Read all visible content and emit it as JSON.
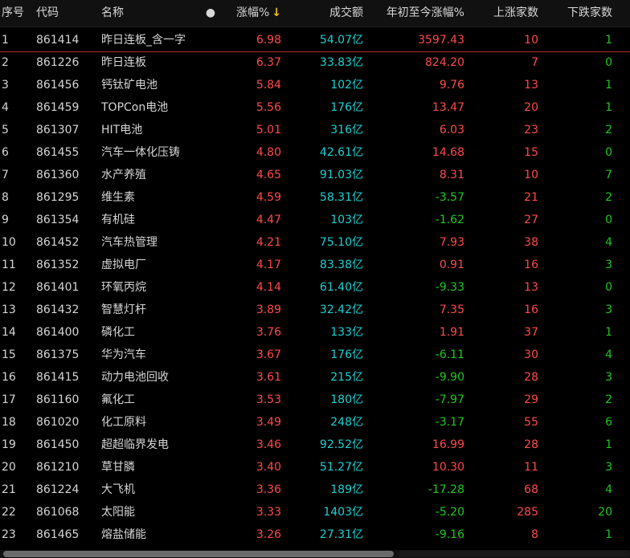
{
  "headers": {
    "idx": "序号",
    "code": "代码",
    "name": "名称",
    "dot": "●",
    "change": "涨幅%",
    "sort_arrow": "↓",
    "volume": "成交额",
    "ytd": "年初至今涨幅%",
    "up": "上涨家数",
    "down": "下跌家数"
  },
  "rows": [
    {
      "idx": "1",
      "code": "861414",
      "name": "昨日连板_含一字",
      "change": "6.98",
      "volume": "54.07亿",
      "ytd": "3597.43",
      "up": "10",
      "down": "1"
    },
    {
      "idx": "2",
      "code": "861226",
      "name": "昨日连板",
      "change": "6.37",
      "volume": "33.83亿",
      "ytd": "824.20",
      "up": "7",
      "down": "0"
    },
    {
      "idx": "3",
      "code": "861456",
      "name": "钙钛矿电池",
      "change": "5.84",
      "volume": "102亿",
      "ytd": "9.76",
      "up": "13",
      "down": "1"
    },
    {
      "idx": "4",
      "code": "861459",
      "name": "TOPCon电池",
      "change": "5.56",
      "volume": "176亿",
      "ytd": "13.47",
      "up": "20",
      "down": "1"
    },
    {
      "idx": "5",
      "code": "861307",
      "name": "HIT电池",
      "change": "5.01",
      "volume": "316亿",
      "ytd": "6.03",
      "up": "23",
      "down": "2"
    },
    {
      "idx": "6",
      "code": "861455",
      "name": "汽车一体化压铸",
      "change": "4.80",
      "volume": "42.61亿",
      "ytd": "14.68",
      "up": "15",
      "down": "0"
    },
    {
      "idx": "7",
      "code": "861360",
      "name": "水产养殖",
      "change": "4.65",
      "volume": "91.03亿",
      "ytd": "8.31",
      "up": "10",
      "down": "7"
    },
    {
      "idx": "8",
      "code": "861295",
      "name": "维生素",
      "change": "4.59",
      "volume": "58.31亿",
      "ytd": "-3.57",
      "up": "21",
      "down": "2"
    },
    {
      "idx": "9",
      "code": "861354",
      "name": "有机硅",
      "change": "4.47",
      "volume": "103亿",
      "ytd": "-1.62",
      "up": "27",
      "down": "0"
    },
    {
      "idx": "10",
      "code": "861452",
      "name": "汽车热管理",
      "change": "4.21",
      "volume": "75.10亿",
      "ytd": "7.93",
      "up": "38",
      "down": "4"
    },
    {
      "idx": "11",
      "code": "861352",
      "name": "虚拟电厂",
      "change": "4.17",
      "volume": "83.38亿",
      "ytd": "0.91",
      "up": "16",
      "down": "3"
    },
    {
      "idx": "12",
      "code": "861401",
      "name": "环氧丙烷",
      "change": "4.14",
      "volume": "61.40亿",
      "ytd": "-9.33",
      "up": "13",
      "down": "0"
    },
    {
      "idx": "13",
      "code": "861432",
      "name": "智慧灯杆",
      "change": "3.89",
      "volume": "32.42亿",
      "ytd": "7.35",
      "up": "16",
      "down": "3"
    },
    {
      "idx": "14",
      "code": "861400",
      "name": "磷化工",
      "change": "3.76",
      "volume": "133亿",
      "ytd": "1.91",
      "up": "37",
      "down": "1"
    },
    {
      "idx": "15",
      "code": "861375",
      "name": "华为汽车",
      "change": "3.67",
      "volume": "176亿",
      "ytd": "-6.11",
      "up": "30",
      "down": "4"
    },
    {
      "idx": "16",
      "code": "861415",
      "name": "动力电池回收",
      "change": "3.61",
      "volume": "215亿",
      "ytd": "-9.90",
      "up": "28",
      "down": "3"
    },
    {
      "idx": "17",
      "code": "861160",
      "name": "氟化工",
      "change": "3.53",
      "volume": "180亿",
      "ytd": "-7.97",
      "up": "29",
      "down": "2"
    },
    {
      "idx": "18",
      "code": "861020",
      "name": "化工原料",
      "change": "3.49",
      "volume": "248亿",
      "ytd": "-3.17",
      "up": "55",
      "down": "6"
    },
    {
      "idx": "19",
      "code": "861450",
      "name": "超超临界发电",
      "change": "3.46",
      "volume": "92.52亿",
      "ytd": "16.99",
      "up": "28",
      "down": "1"
    },
    {
      "idx": "20",
      "code": "861210",
      "name": "草甘膦",
      "change": "3.40",
      "volume": "51.27亿",
      "ytd": "10.30",
      "up": "11",
      "down": "3"
    },
    {
      "idx": "21",
      "code": "861224",
      "name": "大飞机",
      "change": "3.36",
      "volume": "189亿",
      "ytd": "-17.28",
      "up": "68",
      "down": "4"
    },
    {
      "idx": "22",
      "code": "861068",
      "name": "太阳能",
      "change": "3.33",
      "volume": "1403亿",
      "ytd": "-5.20",
      "up": "285",
      "down": "20"
    },
    {
      "idx": "23",
      "code": "861465",
      "name": "熔盐储能",
      "change": "3.26",
      "volume": "27.31亿",
      "ytd": "-9.16",
      "up": "8",
      "down": "1"
    }
  ],
  "colors": {
    "up": "#ff4a4a",
    "down": "#1ec81e",
    "volume": "#1bd0d0",
    "neutral": "#d6d6d6",
    "sort_arrow": "#f2c000"
  }
}
